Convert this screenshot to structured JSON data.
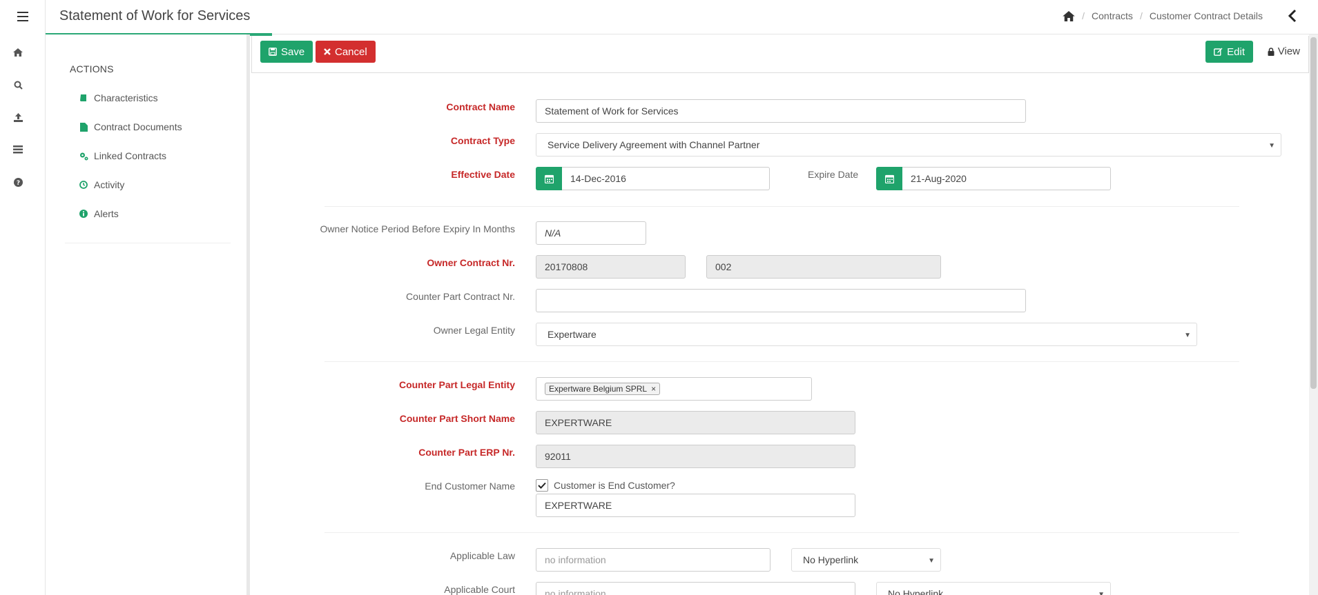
{
  "header": {
    "title": "Statement of Work for Services",
    "breadcrumbs": [
      "Contracts",
      "Customer Contract Details"
    ]
  },
  "rail": {
    "icons": [
      "home-icon",
      "search-icon",
      "upload-icon",
      "list-icon",
      "help-icon"
    ]
  },
  "sidebar": {
    "heading": "ACTIONS",
    "items": [
      {
        "label": "Characteristics",
        "icon": "book-icon"
      },
      {
        "label": "Contract Documents",
        "icon": "file-icon"
      },
      {
        "label": "Linked Contracts",
        "icon": "cogs-icon"
      },
      {
        "label": "Activity",
        "icon": "clock-icon"
      },
      {
        "label": "Alerts",
        "icon": "info-icon"
      }
    ]
  },
  "toolbar": {
    "save_label": "Save",
    "cancel_label": "Cancel",
    "edit_label": "Edit",
    "view_label": "View"
  },
  "form": {
    "contract_name": {
      "label": "Contract Name",
      "value": "Statement of Work for Services"
    },
    "contract_type": {
      "label": "Contract Type",
      "value": "Service Delivery Agreement with Channel Partner"
    },
    "effective_date": {
      "label": "Effective Date",
      "value": "14-Dec-2016"
    },
    "expire_date": {
      "label": "Expire Date",
      "value": "21-Aug-2020"
    },
    "notice_period": {
      "label": "Owner Notice Period Before Expiry In Months",
      "value": "N/A"
    },
    "owner_contract_nr": {
      "label": "Owner Contract Nr.",
      "value": "20170808",
      "suffix": "002"
    },
    "counter_part_contract_nr": {
      "label": "Counter Part Contract Nr.",
      "value": ""
    },
    "owner_legal_entity": {
      "label": "Owner Legal Entity",
      "value": "Expertware"
    },
    "counter_part_legal_entity": {
      "label": "Counter Part Legal Entity",
      "tag": "Expertware Belgium SPRL",
      "tag_remove": "×"
    },
    "counter_part_short_name": {
      "label": "Counter Part Short Name",
      "value": "EXPERTWARE"
    },
    "counter_part_erp_nr": {
      "label": "Counter Part ERP Nr.",
      "value": "92011"
    },
    "end_customer_name": {
      "label": "End Customer Name",
      "checkbox_label": "Customer is End Customer?",
      "value": "EXPERTWARE"
    },
    "applicable_law": {
      "label": "Applicable Law",
      "placeholder": "no information",
      "hyperlink": "No Hyperlink"
    },
    "applicable_court": {
      "label": "Applicable Court",
      "placeholder": "no information",
      "hyperlink": "No Hyperlink"
    }
  },
  "colors": {
    "accent": "#1fa36b",
    "danger": "#d32f2f",
    "required": "#c62828"
  }
}
